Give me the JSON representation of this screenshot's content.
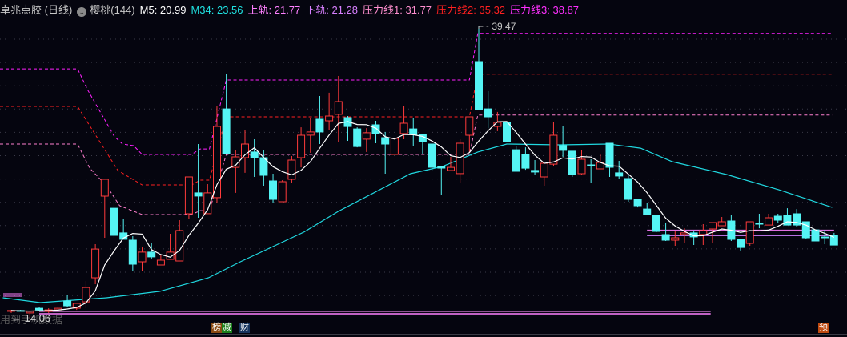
{
  "header": {
    "stock": "卓兆点胶 (日线)",
    "dropdown_icon": "chevron-down-circle",
    "indicator": "樱桃(144)",
    "m5": "M5: 20.99",
    "m34": "M34: 23.56",
    "upper": "上轨: 21.77",
    "lower": "下轨: 21.28",
    "p1": "压力线1: 31.77",
    "p2": "压力线2: 35.32",
    "p3": "压力线3: 38.87"
  },
  "colors": {
    "up": "#ff3b3b",
    "down": "#54f4f4",
    "m5": "#ffffff",
    "m34": "#20d8e0",
    "upper": "#ff80ff",
    "lower": "#d080ff",
    "p1": "#ff7fcf",
    "p2": "#ff2020",
    "p3": "#ff20ff",
    "grid": "#3a3a48"
  },
  "labels": {
    "high": "39.47",
    "low": "14.06",
    "ghost": "用到手机数据",
    "badge_bang": "榜",
    "badge_jian": "减",
    "badge_cai": "财",
    "badge_yu": "预"
  },
  "chart_data": {
    "type": "candlestick",
    "title": "卓兆点胶 (日线)",
    "high_marker": 39.47,
    "low_marker": 14.06,
    "candles_ohlc": [
      [
        14.7,
        14.83,
        14.56,
        14.77
      ],
      [
        14.77,
        14.83,
        14.7,
        14.7
      ],
      [
        14.56,
        14.77,
        14.06,
        14.7
      ],
      [
        14.97,
        15.11,
        14.77,
        14.83
      ],
      [
        14.7,
        14.97,
        14.56,
        14.83
      ],
      [
        14.83,
        15.11,
        14.7,
        14.97
      ],
      [
        15.6,
        16.09,
        15.11,
        15.18
      ],
      [
        14.97,
        15.39,
        14.83,
        15.39
      ],
      [
        15.53,
        17.34,
        14.97,
        16.78
      ],
      [
        17.62,
        20.54,
        17.06,
        20.12
      ],
      [
        24.72,
        26.18,
        21.1,
        26.18
      ],
      [
        23.67,
        25.0,
        21.1,
        21.31
      ],
      [
        21.52,
        22.7,
        20.96,
        20.96
      ],
      [
        20.89,
        21.24,
        18.18,
        18.8
      ],
      [
        19.01,
        20.26,
        18.18,
        19.85
      ],
      [
        19.85,
        20.68,
        19.29,
        19.43
      ],
      [
        18.73,
        19.57,
        18.73,
        19.15
      ],
      [
        19.22,
        21.45,
        19.22,
        19.85
      ],
      [
        19.08,
        22.63,
        19.08,
        21.73
      ],
      [
        23.19,
        26.39,
        22.77,
        26.39
      ],
      [
        25.0,
        29.24,
        22.84,
        24.72
      ],
      [
        23.19,
        25.76,
        23.19,
        25.0
      ],
      [
        24.58,
        32.51,
        24.16,
        30.77
      ],
      [
        32.3,
        35.37,
        28.34,
        28.41
      ],
      [
        27.22,
        28.69,
        25.0,
        28.13
      ],
      [
        28.06,
        30.49,
        26.74,
        29.24
      ],
      [
        28.55,
        29.66,
        26.39,
        28.06
      ],
      [
        28.06,
        28.75,
        25.62,
        26.53
      ],
      [
        26.04,
        26.67,
        24.16,
        24.44
      ],
      [
        24.23,
        26.11,
        24.23,
        25.97
      ],
      [
        26.18,
        28.2,
        25.9,
        27.85
      ],
      [
        28.06,
        30.7,
        27.22,
        30.01
      ],
      [
        30.01,
        31.47,
        28.48,
        30.29
      ],
      [
        31.4,
        33.42,
        29.24,
        30.29
      ],
      [
        31.26,
        33.7,
        30.43,
        31.68
      ],
      [
        31.82,
        35.16,
        29.38,
        32.93
      ],
      [
        31.54,
        31.68,
        29.52,
        30.77
      ],
      [
        30.56,
        30.7,
        28.96,
        29.03
      ],
      [
        29.66,
        30.63,
        28.55,
        30.22
      ],
      [
        30.91,
        31.26,
        29.31,
        30.15
      ],
      [
        29.8,
        30.29,
        26.67,
        29.24
      ],
      [
        28.34,
        29.73,
        28.34,
        29.73
      ],
      [
        30.15,
        32.58,
        29.66,
        31.05
      ],
      [
        30.56,
        31.47,
        29.03,
        30.08
      ],
      [
        30.08,
        30.08,
        28.34,
        29.45
      ],
      [
        29.24,
        29.24,
        26.95,
        27.22
      ],
      [
        27.29,
        27.29,
        24.86,
        27.15
      ],
      [
        26.95,
        28.13,
        26.95,
        27.22
      ],
      [
        26.67,
        29.66,
        25.9,
        29.31
      ],
      [
        30.01,
        31.61,
        28.55,
        31.61
      ],
      [
        36.41,
        39.47,
        32.23,
        32.23
      ],
      [
        32.3,
        33.84,
        30.63,
        31.61
      ],
      [
        30.77,
        32.03,
        30.36,
        31.12
      ],
      [
        31.12,
        31.12,
        29.45,
        29.45
      ],
      [
        28.75,
        29.1,
        26.88,
        26.88
      ],
      [
        28.34,
        28.96,
        27.01,
        27.15
      ],
      [
        26.95,
        27.85,
        26.6,
        26.81
      ],
      [
        26.39,
        27.57,
        25.62,
        27.57
      ],
      [
        27.5,
        31.12,
        27.29,
        30.01
      ],
      [
        29.1,
        30.77,
        28.13,
        28.69
      ],
      [
        28.62,
        28.62,
        26.39,
        26.6
      ],
      [
        26.67,
        28.69,
        26.53,
        27.92
      ],
      [
        27.43,
        27.92,
        25.83,
        27.36
      ],
      [
        27.08,
        28.34,
        27.08,
        27.64
      ],
      [
        29.31,
        29.31,
        26.39,
        27.22
      ],
      [
        26.74,
        27.78,
        26.18,
        26.46
      ],
      [
        26.25,
        26.6,
        24.23,
        24.44
      ],
      [
        24.44,
        24.44,
        23.74,
        23.88
      ],
      [
        23.6,
        24.09,
        23.05,
        23.12
      ],
      [
        23.05,
        23.05,
        21.59,
        21.66
      ],
      [
        21.38,
        22.35,
        20.82,
        20.89
      ],
      [
        20.89,
        21.66,
        20.4,
        21.1
      ],
      [
        21.38,
        21.93,
        20.68,
        21.52
      ],
      [
        21.52,
        21.73,
        20.47,
        21.17
      ],
      [
        21.38,
        22.28,
        20.47,
        21.73
      ],
      [
        21.86,
        22.42,
        20.68,
        22.42
      ],
      [
        22.14,
        22.91,
        22.14,
        22.49
      ],
      [
        22.56,
        23.05,
        20.82,
        20.96
      ],
      [
        20.96,
        20.96,
        19.92,
        20.26
      ],
      [
        20.61,
        22.49,
        20.4,
        22.49
      ],
      [
        22.35,
        23.19,
        21.93,
        22.28
      ],
      [
        22.21,
        23.19,
        22.21,
        22.84
      ],
      [
        22.98,
        23.19,
        22.35,
        22.63
      ],
      [
        23.05,
        23.67,
        22.21,
        22.21
      ],
      [
        23.19,
        23.6,
        22.07,
        22.21
      ],
      [
        22.49,
        22.49,
        20.96,
        21.1
      ],
      [
        21.79,
        21.79,
        20.82,
        20.82
      ],
      [
        21.17,
        21.79,
        20.54,
        21.1
      ],
      [
        21.31,
        21.52,
        20.47,
        20.47
      ]
    ],
    "ma34_points": [
      [
        0.1,
        15.88
      ],
      [
        4.1,
        15.46
      ],
      [
        11.2,
        15.88
      ],
      [
        16.9,
        16.44
      ],
      [
        22.1,
        17.62
      ],
      [
        25.5,
        19.01
      ],
      [
        32.3,
        21.59
      ],
      [
        36.0,
        23.4
      ],
      [
        43.7,
        26.67
      ],
      [
        47.1,
        27.29
      ],
      [
        50.9,
        28.55
      ],
      [
        54.0,
        29.24
      ],
      [
        59.7,
        29.17
      ],
      [
        64.9,
        29.24
      ],
      [
        68.3,
        28.89
      ],
      [
        71.7,
        27.71
      ],
      [
        77.5,
        26.6
      ],
      [
        83.1,
        25.27
      ],
      [
        88.8,
        23.74
      ]
    ],
    "pressure3": [
      [
        -0.2,
        35.78
      ],
      [
        8.1,
        35.78
      ],
      [
        9.2,
        33.91
      ],
      [
        12.0,
        29.94
      ],
      [
        12.9,
        29.24
      ],
      [
        14.1,
        29.1
      ],
      [
        15.0,
        28.34
      ],
      [
        20.3,
        28.34
      ],
      [
        21.2,
        28.82
      ],
      [
        22.2,
        28.82
      ],
      [
        24.0,
        34.81
      ],
      [
        50.0,
        34.81
      ],
      [
        50.9,
        38.87
      ],
      [
        88.8,
        38.87
      ]
    ],
    "pressure2": [
      [
        -0.2,
        32.51
      ],
      [
        8.1,
        32.51
      ],
      [
        12.4,
        26.95
      ],
      [
        15.0,
        25.69
      ],
      [
        20.3,
        25.69
      ],
      [
        21.2,
        26.11
      ],
      [
        22.2,
        26.11
      ],
      [
        24.0,
        31.61
      ],
      [
        50.0,
        31.61
      ],
      [
        50.9,
        35.32
      ],
      [
        88.8,
        35.32
      ]
    ],
    "pressure1": [
      [
        -0.2,
        29.24
      ],
      [
        8.1,
        29.24
      ],
      [
        9.4,
        27.15
      ],
      [
        11.2,
        25.62
      ],
      [
        12.6,
        23.88
      ],
      [
        15.0,
        23.12
      ],
      [
        20.3,
        23.12
      ],
      [
        21.2,
        23.46
      ],
      [
        22.2,
        23.46
      ],
      [
        24.0,
        28.34
      ],
      [
        50.0,
        28.34
      ],
      [
        50.9,
        31.77
      ],
      [
        88.8,
        31.77
      ]
    ],
    "upper_band": {
      "from": 69,
      "to": 89,
      "value": 21.77
    },
    "lower_band": {
      "from": 69,
      "to": 89,
      "value": 21.28
    },
    "bottom_lines": [
      {
        "from": 4,
        "to": 75.8,
        "value": 14.7
      },
      {
        "from": 4,
        "to": 75.8,
        "value": 14.49
      }
    ],
    "price_range": [
      14.0,
      39.6
    ]
  }
}
